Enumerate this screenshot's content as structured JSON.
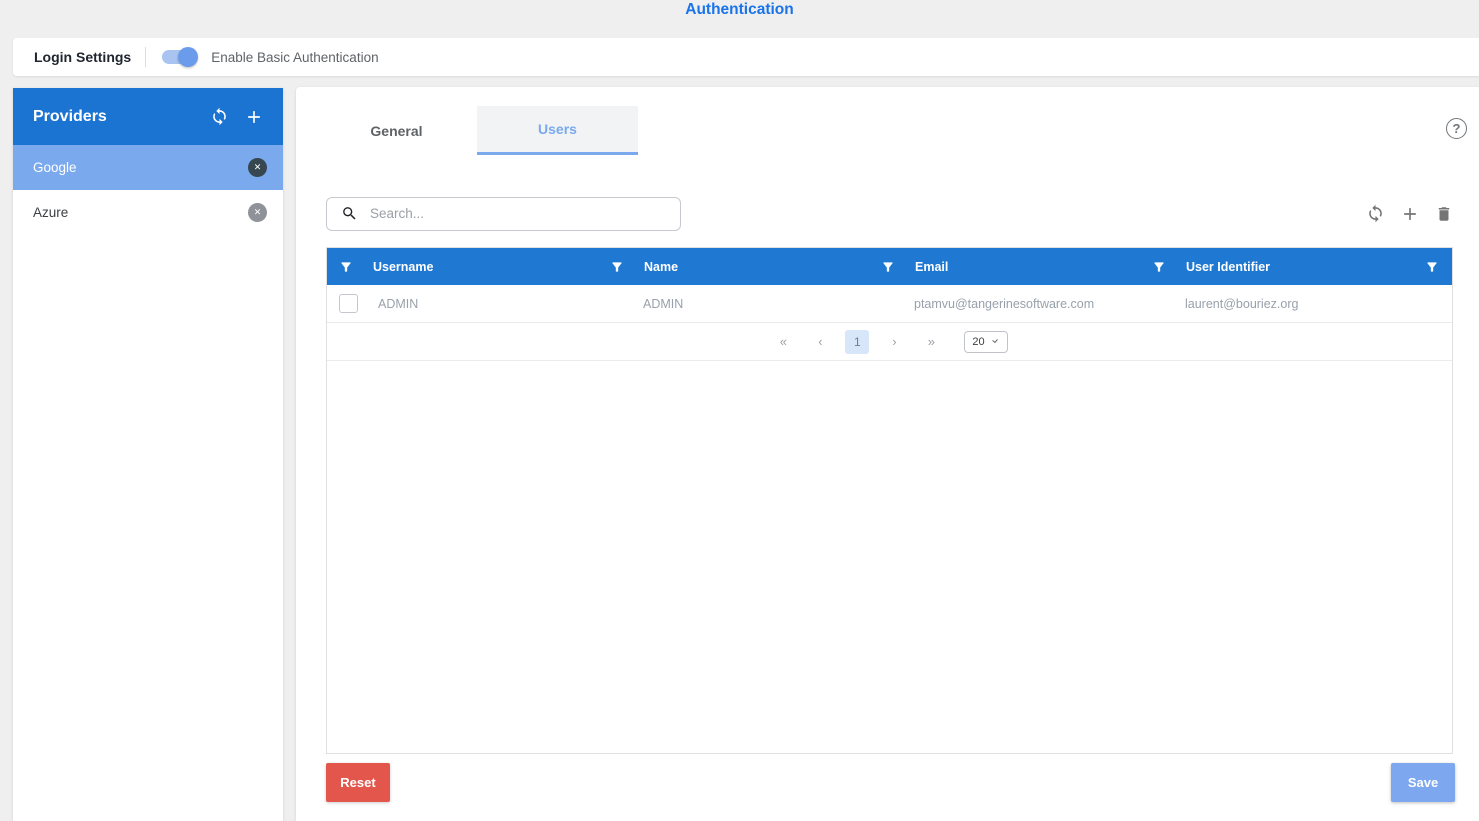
{
  "header": {
    "title": "Authentication"
  },
  "login_bar": {
    "label": "Login Settings",
    "toggle_label": "Enable Basic Authentication",
    "toggle_on": true
  },
  "sidebar": {
    "title": "Providers",
    "items": [
      {
        "label": "Google",
        "selected": true
      },
      {
        "label": "Azure",
        "selected": false
      }
    ]
  },
  "tabs": [
    {
      "label": "General",
      "active": false
    },
    {
      "label": "Users",
      "active": true
    }
  ],
  "help": {
    "glyph": "?"
  },
  "search": {
    "placeholder": "Search...",
    "value": ""
  },
  "table": {
    "columns": [
      "Username",
      "Name",
      "Email",
      "User Identifier"
    ],
    "rows": [
      {
        "checked": false,
        "username": "ADMIN",
        "name": "ADMIN",
        "email": "ptamvu@tangerinesoftware.com",
        "user_identifier": "laurent@bouriez.org"
      }
    ]
  },
  "pagination": {
    "first": "«",
    "prev": "‹",
    "page": "1",
    "next": "›",
    "last": "»",
    "page_size": "20"
  },
  "footer": {
    "reset_label": "Reset",
    "save_label": "Save"
  },
  "icons": {
    "close": "✕",
    "plus": "+",
    "help": "?",
    "sync": "sync-circular-arrows",
    "trash": "trash-can",
    "filter": "funnel",
    "search": "magnifier",
    "select_caret": "chevron-down"
  },
  "colors": {
    "accent_title_blue": "#1a73e8",
    "sidebar_header_blue": "#1b74d1",
    "table_header_blue": "#1f78d2",
    "selected_item_blue": "#7aa9ee",
    "save_button_blue": "#7da7ef",
    "reset_button_red": "#e2564c",
    "active_page_bg": "#d7e6f9",
    "page_background": "#efeff0"
  }
}
